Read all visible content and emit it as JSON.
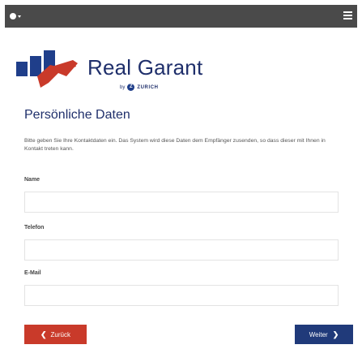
{
  "header": {
    "language_icon": "globe-icon",
    "menu_icon": "hamburger-menu-icon"
  },
  "brand": {
    "name": "Real Garant",
    "by_text": "by",
    "partner": "ZURICH",
    "logo_colors": {
      "navy": "#1f3e8a",
      "red": "#c93a2a"
    }
  },
  "page": {
    "title": "Persönliche Daten",
    "intro": "Bitte geben Sie Ihre Kontaktdaten ein. Das System wird diese Daten dem Empfänger zusenden, so dass dieser mit Ihnen in Kontakt treten kann."
  },
  "form": {
    "name_label": "Name",
    "name_value": "",
    "phone_label": "Telefon",
    "phone_value": "",
    "email_label": "E-Mail",
    "email_value": ""
  },
  "nav": {
    "back_label": "Zurück",
    "next_label": "Weiter"
  },
  "colors": {
    "topbar": "#4a4a4a",
    "primary": "#203a7a",
    "accent": "#c93a2a",
    "title": "#1f2f6b"
  }
}
